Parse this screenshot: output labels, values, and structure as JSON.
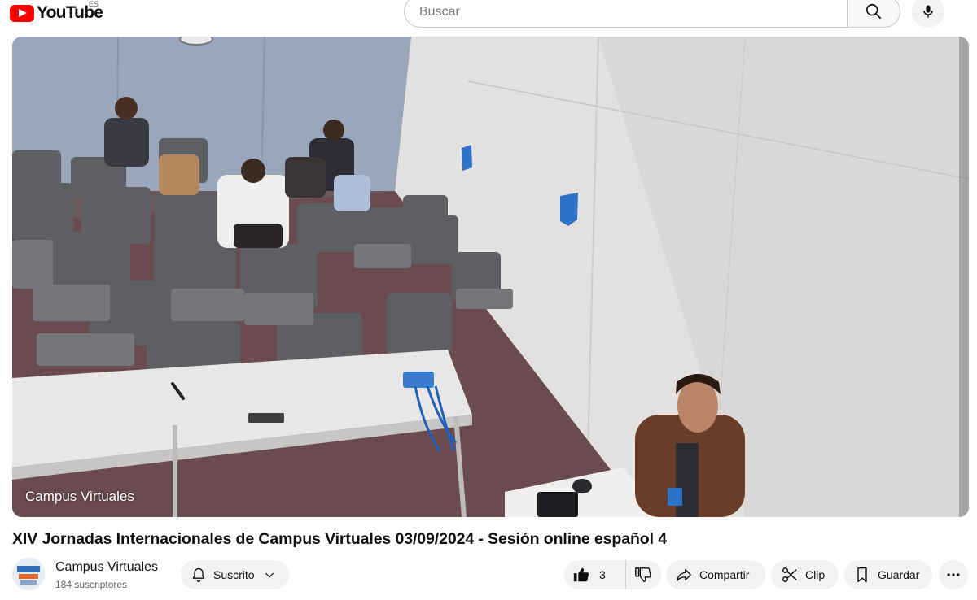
{
  "masthead": {
    "logo_text": "YouTube",
    "country_code": "ES",
    "search_placeholder": "Buscar"
  },
  "player": {
    "watermark": "Campus Virtuales"
  },
  "video": {
    "title": "XIV Jornadas Internacionales de Campus Virtuales 03/09/2024 - Sesión online español 4"
  },
  "owner": {
    "channel_name": "Campus Virtuales",
    "subscribers": "184 suscriptores",
    "subscribe_label": "Suscrito"
  },
  "actions": {
    "like_count": "3",
    "share_label": "Compartir",
    "clip_label": "Clip",
    "save_label": "Guardar"
  },
  "icons": {
    "search": "search-icon",
    "mic": "mic-icon",
    "bell": "bell-icon",
    "like": "thumbs-up-icon",
    "dislike": "thumbs-down-icon",
    "share": "share-arrow-icon",
    "clip": "scissors-icon",
    "save": "bookmark-icon",
    "more": "more-horizontal-icon"
  },
  "colors": {
    "brand": "#ff0000",
    "pill": "#f2f2f2",
    "text": "#0f0f0f",
    "secondary_text": "#606060"
  }
}
